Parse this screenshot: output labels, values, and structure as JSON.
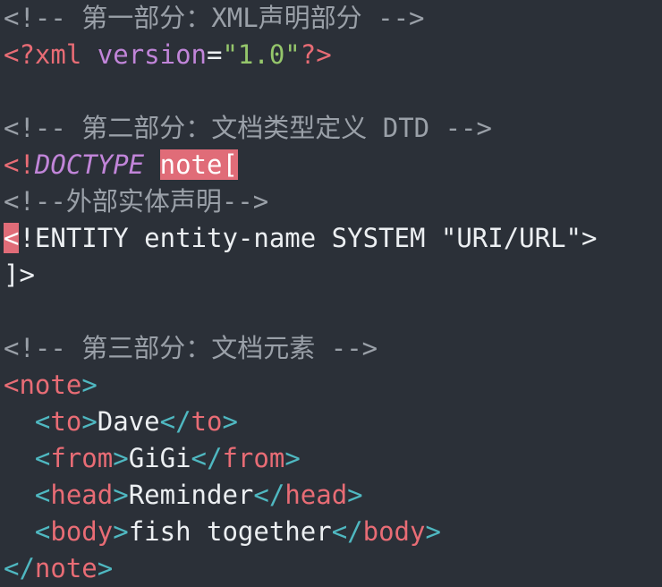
{
  "code": {
    "comment_part1": "<!-- 第一部分：XML声明部分 -->",
    "xml_decl": {
      "open": "<?",
      "name": "xml",
      "attr": "version",
      "eq": "=",
      "value": "\"1.0\"",
      "close": "?>"
    },
    "comment_part2": "<!-- 第二部分：文档类型定义 DTD -->",
    "doctype": {
      "open": "<!",
      "keyword": "DOCTYPE",
      "name": "note[",
      "space": " "
    },
    "comment_external": "<!--外部实体声明-->",
    "entity": {
      "lt": "<",
      "rest": "!ENTITY entity-name SYSTEM \"URI/URL\">"
    },
    "doctype_close": "]>",
    "comment_part3": "<!-- 第三部分：文档元素 -->",
    "elements": {
      "note_open": "note",
      "note_close": "note",
      "to": {
        "tag": "to",
        "text": "Dave"
      },
      "from": {
        "tag": "from",
        "text": "GiGi"
      },
      "head": {
        "tag": "head",
        "text": "Reminder"
      },
      "body": {
        "tag": "body",
        "text": "fish together"
      }
    },
    "punct": {
      "lt": "<",
      "gt": ">",
      "lt_slash": "</"
    }
  }
}
